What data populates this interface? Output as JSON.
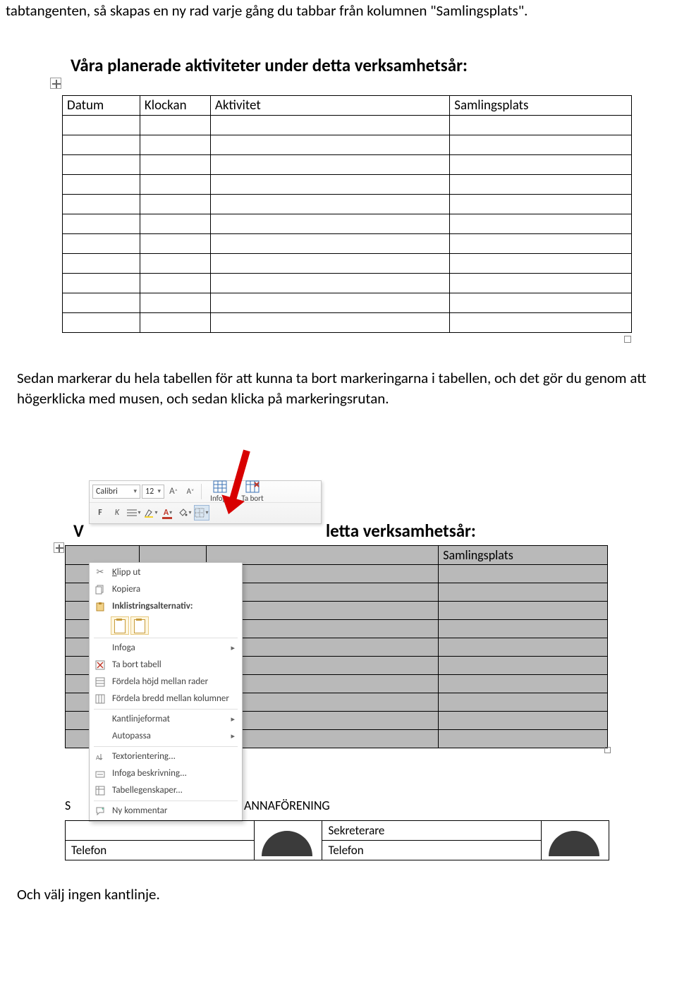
{
  "intro": "tabtangenten, så skapas en ny rad varje gång du tabbar från kolumnen \"Samlingsplats\".",
  "heading": "Våra planerade aktiviteter under detta verksamhetsår:",
  "table_headers": {
    "c1": "Datum",
    "c2": "Klockan",
    "c3": "Aktivitet",
    "c4": "Samlingsplats"
  },
  "para2": "Sedan markerar du hela tabellen för att kunna ta bort markeringarna i tabellen, och det gör du genom att högerklicka med musen, och sedan klicka på markeringsrutan.",
  "mini_toolbar": {
    "font_name": "Calibri",
    "font_size": "12",
    "grow_a": "Aˆ",
    "shrink_a": "Aˇ",
    "bold": "F",
    "italic": "K",
    "insert_label": "Infoga",
    "delete_label": "Ta bort"
  },
  "heading2_left": "V",
  "heading2_right": "letta verksamhetsår:",
  "context_menu": {
    "cut": "Klipp ut",
    "copy": "Kopiera",
    "paste_opts": "Inklistringsalternativ:",
    "insert": "Infoga",
    "del_table": "Ta bort tabell",
    "dist_rows": "Fördela höjd mellan rader",
    "dist_cols": "Fördela bredd mellan kolumner",
    "border_fmt": "Kantlinjeformat",
    "autofit": "Autopassa",
    "text_dir": "Textorientering...",
    "caption": "Infoga beskrivning...",
    "table_props": "Tabellegenskaper...",
    "new_comment": "Ny kommentar"
  },
  "bottom_doc": {
    "org_prefix": "S",
    "org_right": "ANNAFÖRENING",
    "row1_left": "",
    "row1_right": "Sekreterare",
    "row2_left": "Telefon",
    "row2_right": "Telefon"
  },
  "final_line": "Och välj ingen kantlinje."
}
